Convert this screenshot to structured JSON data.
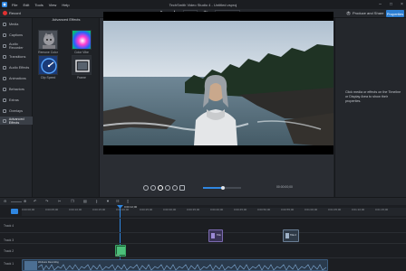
{
  "app": {
    "title": "TechSmith Video Studio 4 - Untitled.vsproj",
    "menu": [
      "File",
      "Edit",
      "Tools",
      "View",
      "Help"
    ],
    "window_controls": [
      "minimize-icon",
      "maximize-icon",
      "close-icon"
    ]
  },
  "toolbar": {
    "record_label": "Record",
    "zoom_value": "61%",
    "resolution": "1920x1080",
    "produce_label": "Produce and Share",
    "properties_label": "Properties"
  },
  "sidebar": {
    "items": [
      {
        "label": "Media",
        "icon": "media-icon"
      },
      {
        "label": "Captions",
        "icon": "captions-icon"
      },
      {
        "label": "Audio Recorder",
        "icon": "microphone-icon"
      },
      {
        "label": "Transitions",
        "icon": "transitions-icon"
      },
      {
        "label": "Audio Effects",
        "icon": "audio-effects-icon"
      },
      {
        "label": "Animations",
        "icon": "animations-icon"
      },
      {
        "label": "Behaviors",
        "icon": "behaviors-icon"
      },
      {
        "label": "Extras",
        "icon": "extras-icon"
      },
      {
        "label": "Overlays",
        "icon": "overlays-icon"
      },
      {
        "label": "Advanced Effects",
        "icon": "advanced-effects-icon"
      }
    ],
    "active_index": 9
  },
  "effects": {
    "header": "Advanced Effects",
    "items": [
      {
        "label": "Remove Color"
      },
      {
        "label": "Color Vibe"
      },
      {
        "label": "Clip Speed"
      },
      {
        "label": "Frame"
      }
    ]
  },
  "player": {
    "timecode": "00:00:00;00"
  },
  "properties": {
    "message": "Click media or effects on the Timeline or Display Area to show their properties."
  },
  "timeline": {
    "ruler_ticks": [
      "0:00:00;00",
      "0:00:05;00",
      "0:00:10;00",
      "0:00:15;00",
      "0:00:20;00",
      "0:00:25;00",
      "0:00:30;00",
      "0:00:35;00",
      "0:00:40;00",
      "0:00:45;00",
      "0:00:50;00",
      "0:00:55;00",
      "0:01:00;00",
      "0:01:05;00",
      "0:01:10;00",
      "0:01:15;00"
    ],
    "playhead_label": "0:00:12;00",
    "tracks": [
      {
        "label": "Track 4"
      },
      {
        "label": "Track 3"
      },
      {
        "label": "Track 2"
      },
      {
        "label": "Track 1"
      }
    ],
    "clips": [
      {
        "label": "Title"
      },
      {
        "label": "Title 2"
      },
      {
        "label": "Beach"
      },
      {
        "label": "Webcam Recording"
      }
    ]
  },
  "colors": {
    "accent": "#2f86e0",
    "record": "#e03131",
    "clip_title": "#7b6ab0",
    "clip_media": "#3aa864",
    "clip_audio": "#3b5c7e"
  }
}
